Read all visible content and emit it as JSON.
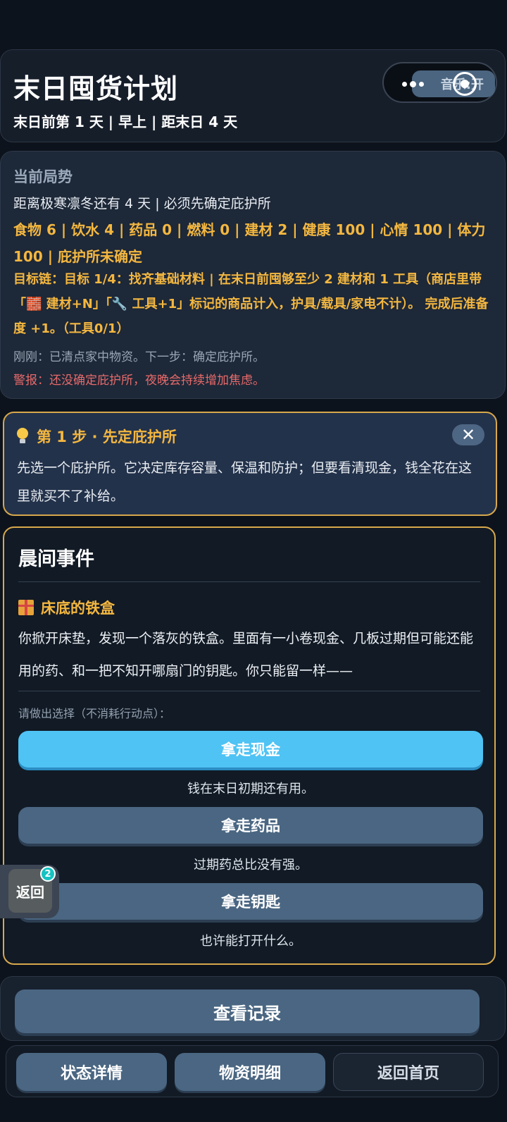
{
  "header": {
    "title": "末日囤货计划",
    "subtitle": "末日前第 1 天 | 早上 | 距末日 4 天",
    "music_label": "音乐:开"
  },
  "status": {
    "section_title": "当前局势",
    "winter_line": "距离极寒凛冬还有 4 天 | 必须先确定庇护所",
    "resources_line": "食物 6 | 饮水 4 | 药品 0 | 燃料 0 | 建材 2 | 健康 100 | 心情 100 | 体力 100 | 庇护所未确定",
    "goal_line": "目标链：目标 1/4：找齐基础材料 | 在末日前囤够至少 2 建材和 1 工具（商店里带「🧱 建材+N」「🔧 工具+1」标记的商品计入，护具/载具/家电不计）。 完成后准备度 +1。（工具0/1）",
    "recent_line": "刚刚：已清点家中物资。下一步：确定庇护所。",
    "warning_line": "警报：还没确定庇护所，夜晚会持续增加焦虑。"
  },
  "tip": {
    "title": "第 1 步 · 先定庇护所",
    "body": "先选一个庇护所。它决定库存容量、保温和防护；但要看清现金，钱全花在这里就买不了补给。",
    "close_glyph": "✕"
  },
  "event": {
    "section_title": "晨间事件",
    "name": "床底的铁盒",
    "description": "你掀开床垫，发现一个落灰的铁盒。里面有一小卷现金、几板过期但可能还能用的药、和一把不知开哪扇门的钥匙。你只能留一样——",
    "prompt": "请做出选择（不消耗行动点）：",
    "choices": [
      {
        "label": "拿走现金",
        "hint": "钱在末日初期还有用。"
      },
      {
        "label": "拿走药品",
        "hint": "过期药总比没有强。"
      },
      {
        "label": "拿走钥匙",
        "hint": "也许能打开什么。"
      }
    ]
  },
  "float_return": {
    "label": "返回",
    "badge": "2"
  },
  "log": {
    "button_label": "查看记录"
  },
  "bottom_nav": {
    "status_label": "状态详情",
    "supplies_label": "物资明细",
    "home_label": "返回首页"
  }
}
